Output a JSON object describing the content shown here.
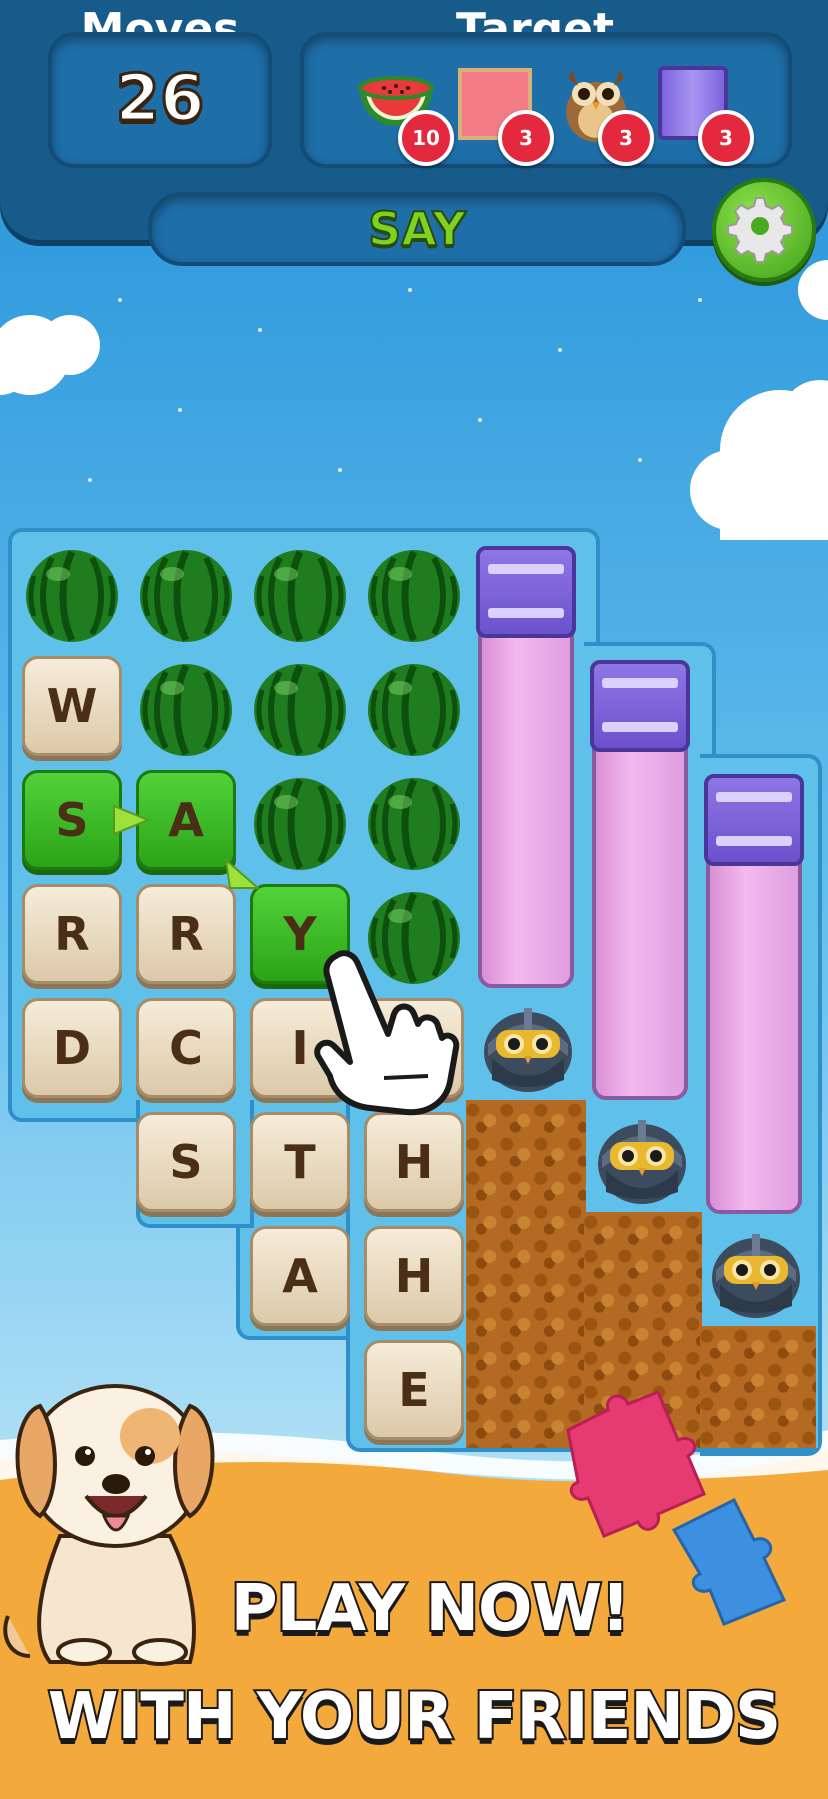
{
  "hud": {
    "moves_label": "Moves",
    "moves_value": "26",
    "target_label": "Target",
    "targets": [
      {
        "item": "watermelon",
        "count": "10"
      },
      {
        "item": "pink-tile",
        "count": "3"
      },
      {
        "item": "owl",
        "count": "3"
      },
      {
        "item": "purple-cap",
        "count": "3"
      }
    ],
    "current_word": "SAY"
  },
  "board": {
    "letters": {
      "w": "W",
      "s1": "S",
      "a1": "A",
      "r1": "R",
      "r2": "R",
      "y": "Y",
      "d": "D",
      "c": "C",
      "i": "I",
      "s2": "S",
      "t": "T",
      "h1": "H",
      "a2": "A",
      "h2": "H",
      "e": "E"
    },
    "selected_path": [
      "S",
      "A",
      "Y"
    ]
  },
  "promo": {
    "line1": "PLAY NOW!",
    "line2": "WITH YOUR FRIENDS"
  },
  "colors": {
    "sky_top": "#1f8fd8",
    "sky_bottom": "#dff3fb",
    "hud": "#175b8a",
    "selected_tile": "#3cbf27",
    "sand": "#f4a93c"
  }
}
